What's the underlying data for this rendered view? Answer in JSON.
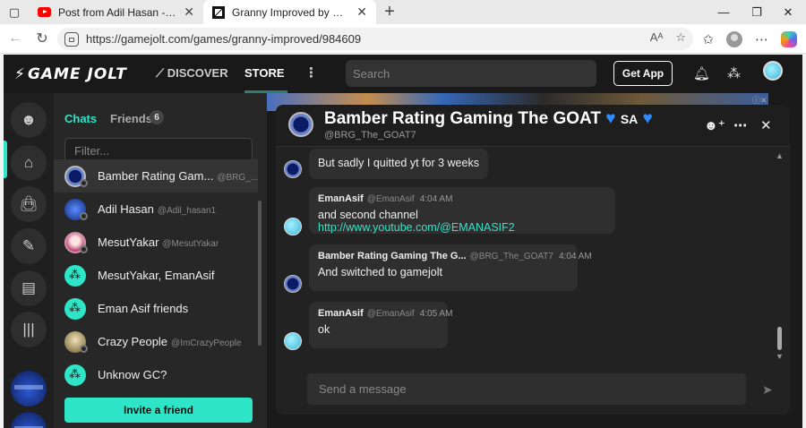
{
  "browser": {
    "tabs": [
      {
        "title": "Post from Adil Hasan - YouTube",
        "icon": "youtube-icon"
      },
      {
        "title": "Granny Improved by PiggyFanFac",
        "icon": "gamejolt-icon"
      }
    ],
    "url": "https://gamejolt.com/games/granny-improved/984609"
  },
  "header": {
    "logo": "GAME JOLT",
    "nav": {
      "discover": "DISCOVER",
      "store": "STORE"
    },
    "search_placeholder": "Search",
    "get_app": "Get App"
  },
  "chat_sidebar": {
    "tab_chats": "Chats",
    "tab_friends": "Friends",
    "friends_count": "6",
    "filter_placeholder": "Filter...",
    "items": [
      {
        "name": "Bamber Rating Gam...",
        "handle": "@BRG_..."
      },
      {
        "name": "Adil Hasan",
        "handle": "@Adil_hasan1"
      },
      {
        "name": "MesutYakar",
        "handle": "@MesutYakar"
      },
      {
        "name": "MesutYakar, EmanAsif",
        "handle": ""
      },
      {
        "name": "Eman Asif friends",
        "handle": ""
      },
      {
        "name": "Crazy People",
        "handle": "@ImCrazyPeople"
      },
      {
        "name": "Unknow GC?",
        "handle": ""
      }
    ],
    "invite_label": "Invite a friend"
  },
  "chat_window": {
    "title": "Bamber Rating Gaming The GOAT",
    "title_suffix": "SA",
    "handle": "@BRG_The_GOAT7",
    "messages": [
      {
        "text": "But sadly I quitted yt for 3 weeks"
      },
      {
        "author": "EmanAsif",
        "handle": "@EmanAsif",
        "time": "4:04 AM",
        "text": "and second channel",
        "link": "http://www.youtube.com/@EMANASIF2"
      },
      {
        "author": "Bamber Rating Gaming The G...",
        "handle": "@BRG_The_GOAT7",
        "time": "4:04 AM",
        "text": "And switched to gamejolt"
      },
      {
        "author": "EmanAsif",
        "handle": "@EmanAsif",
        "time": "4:05 AM",
        "text": "ok"
      }
    ],
    "input_placeholder": "Send a message"
  },
  "colors": {
    "accent": "#2ee6c7",
    "heart": "#2f8cff",
    "background": "#1a1a1a"
  }
}
